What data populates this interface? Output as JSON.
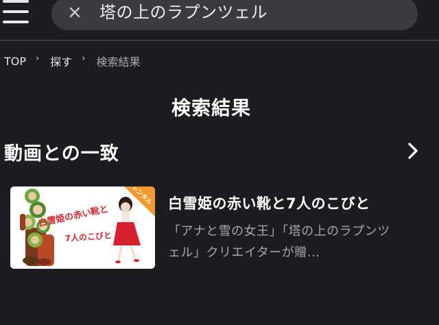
{
  "header": {
    "menu_icon": "hamburger-menu-icon",
    "search": {
      "clear_icon": "close-icon",
      "query": "塔の上のラプンツェル"
    }
  },
  "breadcrumb": {
    "items": [
      "TOP",
      "探す",
      "検索結果"
    ],
    "separator_icon": "chevron-right-icon"
  },
  "page": {
    "title": "検索結果"
  },
  "section": {
    "title": "動画との一致",
    "more_icon": "chevron-right-icon"
  },
  "results": [
    {
      "title": "白雪姫の赤い靴と7人のこびと",
      "description": "「アナと雪の女王」「塔の上のラプンツェル」クリエイターが贈...",
      "thumbnail": {
        "badge": "レンタル",
        "title_line1": "白雪姫の赤い靴と",
        "title_line2": "7人のこびと",
        "badge_color": "#f39a2e"
      }
    }
  ],
  "colors": {
    "background": "#1c1d20",
    "search_box": "#3b3c40",
    "muted_text": "#a7a7aa"
  }
}
